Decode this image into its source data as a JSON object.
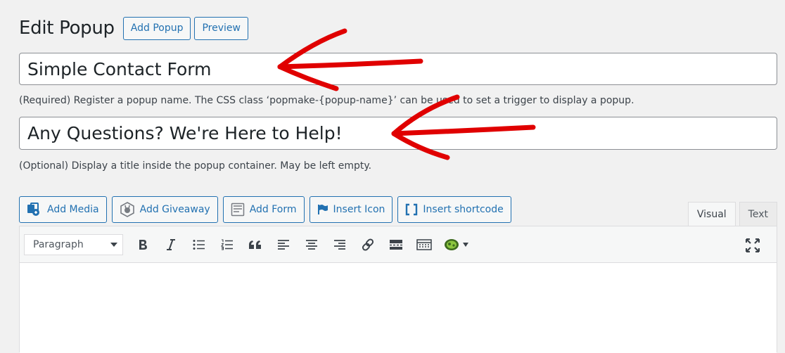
{
  "header": {
    "title": "Edit Popup",
    "add_popup_label": "Add Popup",
    "preview_label": "Preview"
  },
  "popup_name": {
    "value": "Simple Contact Form",
    "help": "(Required) Register a popup name. The CSS class ‘popmake-{popup-name}’ can be used to set a trigger to display a popup."
  },
  "popup_title": {
    "value": "Any Questions? We're Here to Help!",
    "help": "(Optional) Display a title inside the popup container. May be left empty."
  },
  "media_buttons": [
    {
      "label": "Add Media",
      "icon": "add-media-icon"
    },
    {
      "label": "Add Giveaway",
      "icon": "giveaway-icon"
    },
    {
      "label": "Add Form",
      "icon": "form-icon"
    },
    {
      "label": "Insert Icon",
      "icon": "flag-icon"
    },
    {
      "label": "Insert shortcode",
      "icon": "shortcode-icon"
    }
  ],
  "editor_tabs": {
    "visual": "Visual",
    "text": "Text"
  },
  "toolbar": {
    "format_value": "Paragraph",
    "buttons": [
      "bold-icon",
      "italic-icon",
      "bulleted-list-icon",
      "numbered-list-icon",
      "blockquote-icon",
      "align-left-icon",
      "align-center-icon",
      "align-right-icon",
      "link-icon",
      "read-more-icon",
      "toolbar-toggle-icon",
      "plugin-icon",
      "fullscreen-icon"
    ]
  },
  "colors": {
    "accent": "#2271b1",
    "background": "#f1f1f1",
    "annotation_arrow": "#e00000"
  }
}
